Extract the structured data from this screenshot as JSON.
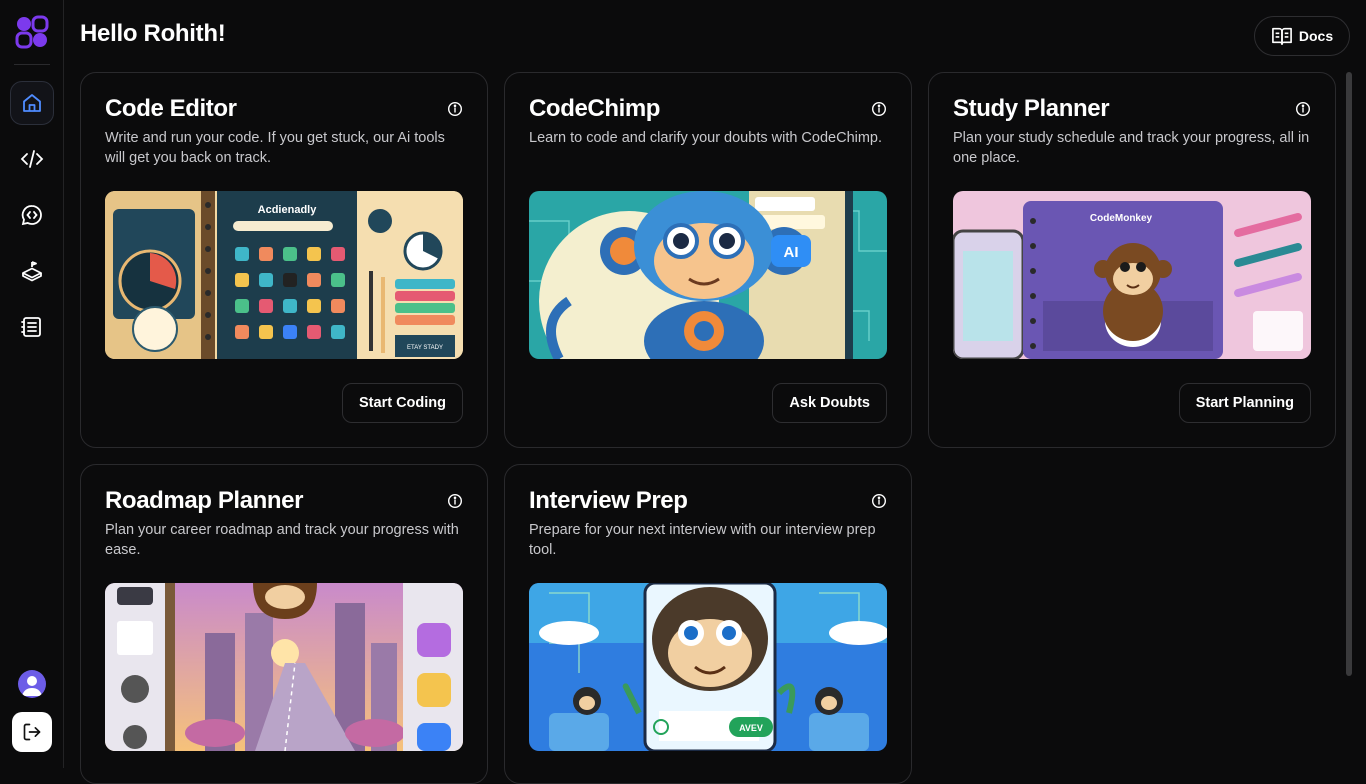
{
  "header": {
    "greeting": "Hello Rohith!",
    "docs_label": "Docs"
  },
  "sidebar": {
    "items": [
      {
        "name": "home",
        "icon": "home-icon",
        "active": true
      },
      {
        "name": "code-editor",
        "icon": "code-icon",
        "active": false
      },
      {
        "name": "codechimp",
        "icon": "chat-code-icon",
        "active": false
      },
      {
        "name": "roadmap",
        "icon": "roadmap-icon",
        "active": false
      },
      {
        "name": "study-planner",
        "icon": "notes-icon",
        "active": false
      }
    ],
    "logout_icon": "logout-icon"
  },
  "cards": [
    {
      "title": "Code Editor",
      "description": "Write and run your code. If you get stuck, our Ai tools will get you back on track.",
      "button": "Start Coding",
      "image_text_1": "Acdienadly",
      "image_text_2": "ETAY STADY"
    },
    {
      "title": "CodeChimp",
      "description": "Learn to code and clarify your doubts with CodeChimp.",
      "button": "Ask Doubts",
      "image_text_1": "AI"
    },
    {
      "title": "Study Planner",
      "description": "Plan your study schedule and track your progress, all in one place.",
      "button": "Start Planning",
      "image_text_1": "CodeMonkey"
    },
    {
      "title": "Roadmap Planner",
      "description": "Plan your career roadmap and track your progress with ease."
    },
    {
      "title": "Interview Prep",
      "description": "Prepare for your next interview with our interview prep tool.",
      "image_text_1": "AVEV"
    }
  ],
  "colors": {
    "background": "#0b0b0c",
    "border": "#2a2a2d",
    "accent": "#7c3aed",
    "active_nav": "#4f8cff"
  }
}
